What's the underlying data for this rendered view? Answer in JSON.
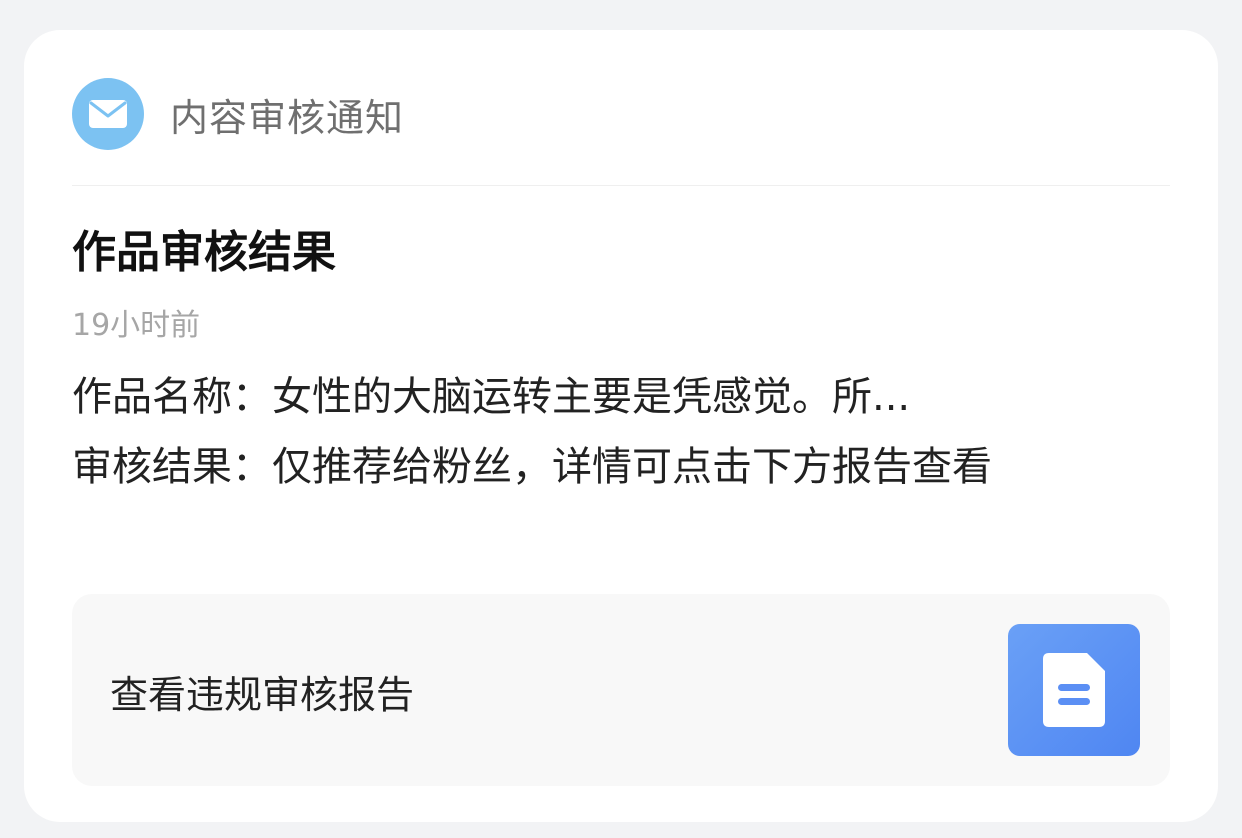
{
  "header": {
    "icon": "mail-icon",
    "title": "内容审核通知"
  },
  "notice": {
    "title": "作品审核结果",
    "time": "19小时前",
    "lines": [
      "作品名称：女性的大脑运转主要是凭感觉。所...",
      "审核结果：仅推荐给粉丝，详情可点击下方报告查看"
    ]
  },
  "report": {
    "label": "查看违规审核报告",
    "icon": "document-icon"
  },
  "colors": {
    "background": "#f2f3f5",
    "card": "#ffffff",
    "avatar": "#7cc2f2",
    "report_thumb": "#5b8ff4",
    "report_box": "#f8f8f8"
  }
}
